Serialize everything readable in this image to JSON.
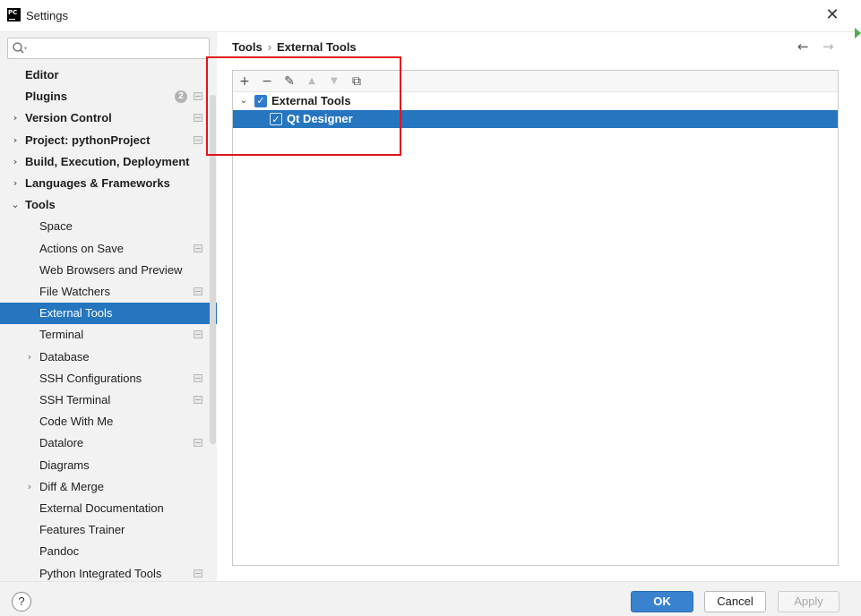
{
  "window": {
    "title": "Settings",
    "close_glyph": "✕"
  },
  "search": {
    "value": "",
    "placeholder": ""
  },
  "sidebar": {
    "items": [
      {
        "label": "Editor",
        "level": 0,
        "bold": true,
        "chevron": "",
        "badge": "",
        "project_icon": false,
        "selected": false
      },
      {
        "label": "Plugins",
        "level": 0,
        "bold": true,
        "chevron": "",
        "badge": "2",
        "project_icon": true,
        "selected": false
      },
      {
        "label": "Version Control",
        "level": 0,
        "bold": true,
        "chevron": "›",
        "badge": "",
        "project_icon": true,
        "selected": false
      },
      {
        "label": "Project: pythonProject",
        "level": 0,
        "bold": true,
        "chevron": "›",
        "badge": "",
        "project_icon": true,
        "selected": false
      },
      {
        "label": "Build, Execution, Deployment",
        "level": 0,
        "bold": true,
        "chevron": "›",
        "badge": "",
        "project_icon": false,
        "selected": false
      },
      {
        "label": "Languages & Frameworks",
        "level": 0,
        "bold": true,
        "chevron": "›",
        "badge": "",
        "project_icon": false,
        "selected": false
      },
      {
        "label": "Tools",
        "level": 0,
        "bold": true,
        "chevron": "⌄",
        "badge": "",
        "project_icon": false,
        "selected": false
      },
      {
        "label": "Space",
        "level": 1,
        "bold": false,
        "chevron": "",
        "badge": "",
        "project_icon": false,
        "selected": false
      },
      {
        "label": "Actions on Save",
        "level": 1,
        "bold": false,
        "chevron": "",
        "badge": "",
        "project_icon": true,
        "selected": false
      },
      {
        "label": "Web Browsers and Preview",
        "level": 1,
        "bold": false,
        "chevron": "",
        "badge": "",
        "project_icon": false,
        "selected": false
      },
      {
        "label": "File Watchers",
        "level": 1,
        "bold": false,
        "chevron": "",
        "badge": "",
        "project_icon": true,
        "selected": false
      },
      {
        "label": "External Tools",
        "level": 1,
        "bold": false,
        "chevron": "",
        "badge": "",
        "project_icon": false,
        "selected": true
      },
      {
        "label": "Terminal",
        "level": 1,
        "bold": false,
        "chevron": "",
        "badge": "",
        "project_icon": true,
        "selected": false
      },
      {
        "label": "Database",
        "level": 1,
        "bold": false,
        "chevron": "›",
        "badge": "",
        "project_icon": false,
        "selected": false
      },
      {
        "label": "SSH Configurations",
        "level": 1,
        "bold": false,
        "chevron": "",
        "badge": "",
        "project_icon": true,
        "selected": false
      },
      {
        "label": "SSH Terminal",
        "level": 1,
        "bold": false,
        "chevron": "",
        "badge": "",
        "project_icon": true,
        "selected": false
      },
      {
        "label": "Code With Me",
        "level": 1,
        "bold": false,
        "chevron": "",
        "badge": "",
        "project_icon": false,
        "selected": false
      },
      {
        "label": "Datalore",
        "level": 1,
        "bold": false,
        "chevron": "",
        "badge": "",
        "project_icon": true,
        "selected": false
      },
      {
        "label": "Diagrams",
        "level": 1,
        "bold": false,
        "chevron": "",
        "badge": "",
        "project_icon": false,
        "selected": false
      },
      {
        "label": "Diff & Merge",
        "level": 1,
        "bold": false,
        "chevron": "›",
        "badge": "",
        "project_icon": false,
        "selected": false
      },
      {
        "label": "External Documentation",
        "level": 1,
        "bold": false,
        "chevron": "",
        "badge": "",
        "project_icon": false,
        "selected": false
      },
      {
        "label": "Features Trainer",
        "level": 1,
        "bold": false,
        "chevron": "",
        "badge": "",
        "project_icon": false,
        "selected": false
      },
      {
        "label": "Pandoc",
        "level": 1,
        "bold": false,
        "chevron": "",
        "badge": "",
        "project_icon": false,
        "selected": false
      },
      {
        "label": "Python Integrated Tools",
        "level": 1,
        "bold": false,
        "chevron": "",
        "badge": "",
        "project_icon": true,
        "selected": false
      }
    ]
  },
  "breadcrumb": {
    "parent": "Tools",
    "separator": "›",
    "current": "External Tools"
  },
  "nav": {
    "back": "←",
    "forward": "→"
  },
  "toolbar": {
    "buttons": [
      {
        "name": "add",
        "glyph": "+",
        "enabled": true
      },
      {
        "name": "remove",
        "glyph": "−",
        "enabled": true
      },
      {
        "name": "edit",
        "glyph": "✎",
        "enabled": true
      },
      {
        "name": "move-up",
        "glyph": "▲",
        "enabled": false
      },
      {
        "name": "move-down",
        "glyph": "▼",
        "enabled": false
      },
      {
        "name": "copy",
        "glyph": "⧉",
        "enabled": true
      }
    ]
  },
  "tools_tree": {
    "group": {
      "label": "External Tools",
      "checked": true,
      "expanded": true,
      "chevron": "⌄"
    },
    "children": [
      {
        "label": "Qt Designer",
        "checked": true,
        "selected": true
      }
    ]
  },
  "checkmark": "✓",
  "footer": {
    "help": "?",
    "ok": "OK",
    "cancel": "Cancel",
    "apply": "Apply"
  },
  "colors": {
    "accent": "#2675bf",
    "highlight_box": "#e0141e",
    "sidebar_bg": "#f2f2f2"
  }
}
